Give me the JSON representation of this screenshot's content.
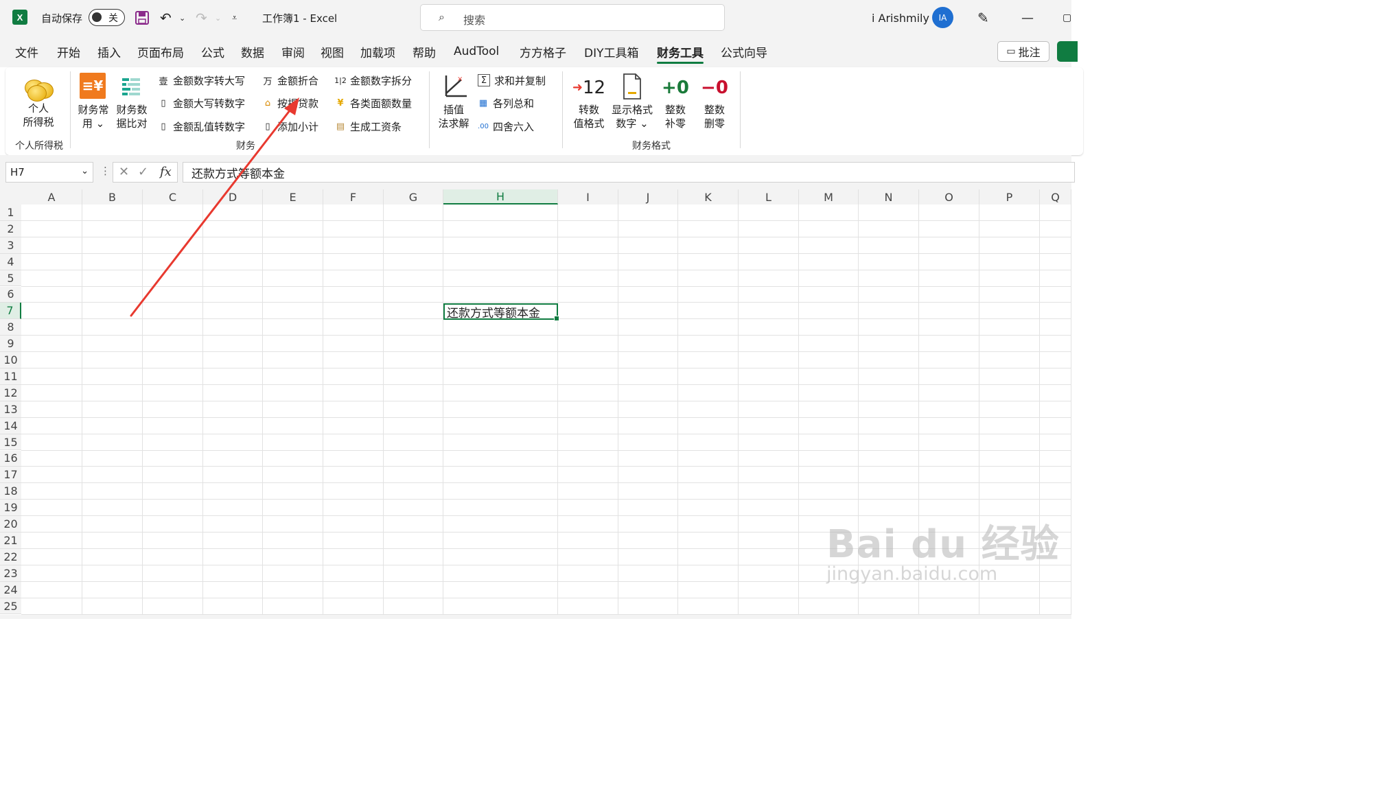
{
  "titlebar": {
    "logo": "X",
    "autosave_label": "自动保存",
    "autosave_state": "关",
    "document_title": "工作簿1  -  Excel",
    "search_placeholder": "搜索",
    "user_name": "i Arishmily",
    "user_initials": "IA"
  },
  "tabs": [
    "文件",
    "开始",
    "插入",
    "页面布局",
    "公式",
    "数据",
    "审阅",
    "视图",
    "加载项",
    "帮助",
    "AudTool",
    "方方格子",
    "DIY工具箱",
    "财务工具",
    "公式向导"
  ],
  "active_tab": "财务工具",
  "comments_label": "批注",
  "ribbon": {
    "groups": {
      "personal_tax": "个人所得税",
      "finance": "财务",
      "finance_format": "财务格式"
    },
    "personal_tax_btn": [
      "个人",
      "所得税"
    ],
    "finance_common": [
      "财务常",
      "用 ⌄"
    ],
    "finance_compare": [
      "财务数",
      "据比对"
    ],
    "col1": [
      "金额数字转大写",
      "金额大写转数字",
      "金额乱值转数字"
    ],
    "col1_icons": [
      "壹",
      "▯",
      "▯"
    ],
    "col2": [
      "金额折合",
      "按揭贷款",
      "添加小计"
    ],
    "col2_icons": [
      "万",
      "⌂",
      "▯"
    ],
    "col3": [
      "金额数字拆分",
      "各类面额数量",
      "生成工资条"
    ],
    "col3_icons": [
      "1|2",
      "¥",
      "▤"
    ],
    "interp": [
      "插值",
      "法求解"
    ],
    "col4": [
      "求和并复制",
      "各列总和",
      "四舍六入"
    ],
    "col4_icons": [
      "Σ",
      "▦",
      ".00"
    ],
    "convert_format": [
      "转数",
      "值格式"
    ],
    "convert_icon": "12",
    "display_format": [
      "显示格式",
      "数字 ⌄"
    ],
    "round_up": [
      "整数",
      "补零"
    ],
    "round_up_icon": "+0",
    "round_del": [
      "整数",
      "删零"
    ],
    "round_del_icon": "−0"
  },
  "formula_bar": {
    "name_box": "H7",
    "cancel": "✕",
    "confirm": "✓",
    "fx": "fx",
    "content": "还款方式等额本金"
  },
  "columns": [
    "A",
    "B",
    "C",
    "D",
    "E",
    "F",
    "G",
    "H",
    "I",
    "J",
    "K",
    "L",
    "M",
    "N",
    "O",
    "P",
    "Q"
  ],
  "rows": [
    "1",
    "2",
    "3",
    "4",
    "5",
    "6",
    "7",
    "8",
    "9",
    "10",
    "11",
    "12",
    "13",
    "14",
    "15",
    "16",
    "17",
    "18",
    "19",
    "20",
    "21",
    "22",
    "23",
    "24",
    "25"
  ],
  "selected_column": "H",
  "selected_row": "7",
  "active_cell_value": "还款方式等额本金",
  "watermark": {
    "brand": "Bai du 经验",
    "url": "jingyan.baidu.com"
  },
  "colors": {
    "excel_green": "#107c41",
    "arrow_red": "#e8392f",
    "avatar_blue": "#1f6fd1"
  }
}
